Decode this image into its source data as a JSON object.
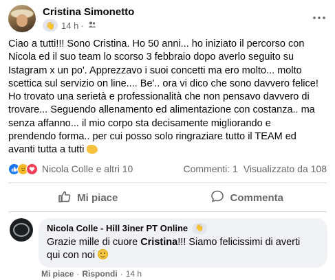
{
  "post": {
    "author": "Cristina Simonetto",
    "time": "14 h",
    "dot": "·",
    "badge_icon": "waving-hand-icon",
    "privacy_icon": "friends-icon",
    "more_icon": "more-options-icon",
    "text_lines": [
      "Ciao a tutti!!! Sono Cristina. Ho 50 anni... ho iniziato il percorso con",
      "Nicola ed il suo team lo scorso 3 febbraio dopo averlo seguito su",
      "Istagram x un po'. Apprezzavo i suoi concetti ma ero molto... molto",
      "scettica sul servizio on line.... Be'.. ora vi dico che sono davvero felice!",
      "Ho trovato una serietà e professionalità che non pensavo davvero di",
      "trovare... Seguendo allenamento ed alimentazione con costanza.. ma",
      "senza affanno... il mio corpo sta decisamente migliorando e",
      "prendendo forma.. per cui posso solo ringraziare tutto il TEAM ed",
      "avanti tutta a tutti"
    ],
    "end_emoji": "flexed-biceps-emoji"
  },
  "stats": {
    "reactions": [
      "like",
      "care",
      "love"
    ],
    "reactors": "Nicola Colle e altri 10",
    "comments": "Commenti: 1",
    "views": "Visualizzato da 108"
  },
  "actions": {
    "like_label": "Mi piace",
    "comment_label": "Commenta"
  },
  "comment": {
    "author": "Nicola Colle - Hill 3iner PT Online",
    "badge_icon": "waving-hand-icon",
    "text_before": "Grazie mille di cuore ",
    "text_bold": "Cristina",
    "text_after_line1": "!!! Siamo felicissimi di averti",
    "text_line2": "qui con noi ",
    "end_emoji": "smiling-face-emoji",
    "like_link": "Mi piace",
    "sep": "·",
    "reply_link": "Rispondi",
    "time": "14 h"
  },
  "colors": {
    "primary_text": "#050505",
    "secondary_text": "#65676b",
    "like_blue": "#1877f2",
    "love_red": "#f33e58",
    "care_yellow": "#f7b928",
    "bubble_bg": "#f0f2f5",
    "divider": "#ced0d4"
  }
}
